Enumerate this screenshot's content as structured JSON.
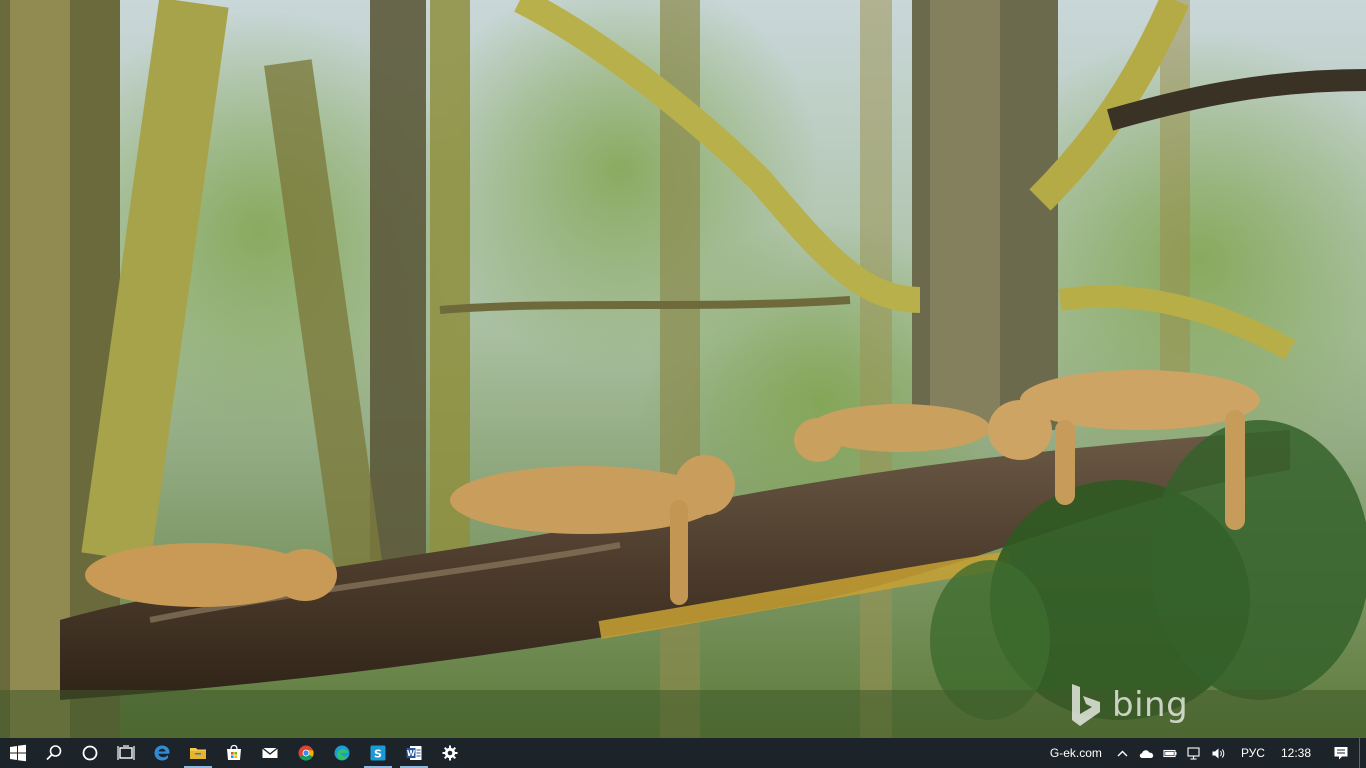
{
  "desktop": {
    "wallpaper": "lionesses-resting-on-tree",
    "watermark_text": "bing"
  },
  "taskbar": {
    "color": "#1c2329",
    "pinned": [
      {
        "icon": "windows-start-icon",
        "name": "start"
      },
      {
        "icon": "search-icon",
        "name": "search"
      },
      {
        "icon": "cortana-icon",
        "name": "cortana"
      },
      {
        "icon": "task-view-icon",
        "name": "task-view"
      },
      {
        "icon": "edge-icon",
        "name": "edge"
      },
      {
        "icon": "file-explorer-icon",
        "name": "file-explorer"
      },
      {
        "icon": "store-icon",
        "name": "store"
      },
      {
        "icon": "mail-icon",
        "name": "mail"
      },
      {
        "icon": "chrome-icon",
        "name": "chrome"
      },
      {
        "icon": "edge-dev-icon",
        "name": "edge-dev"
      },
      {
        "icon": "sway-icon",
        "name": "sway"
      },
      {
        "icon": "word-icon",
        "name": "word"
      },
      {
        "icon": "settings-gear-icon",
        "name": "settings"
      }
    ],
    "tray": {
      "link_text": "G-ek.com",
      "language": "РУС",
      "time": "12:38"
    }
  }
}
